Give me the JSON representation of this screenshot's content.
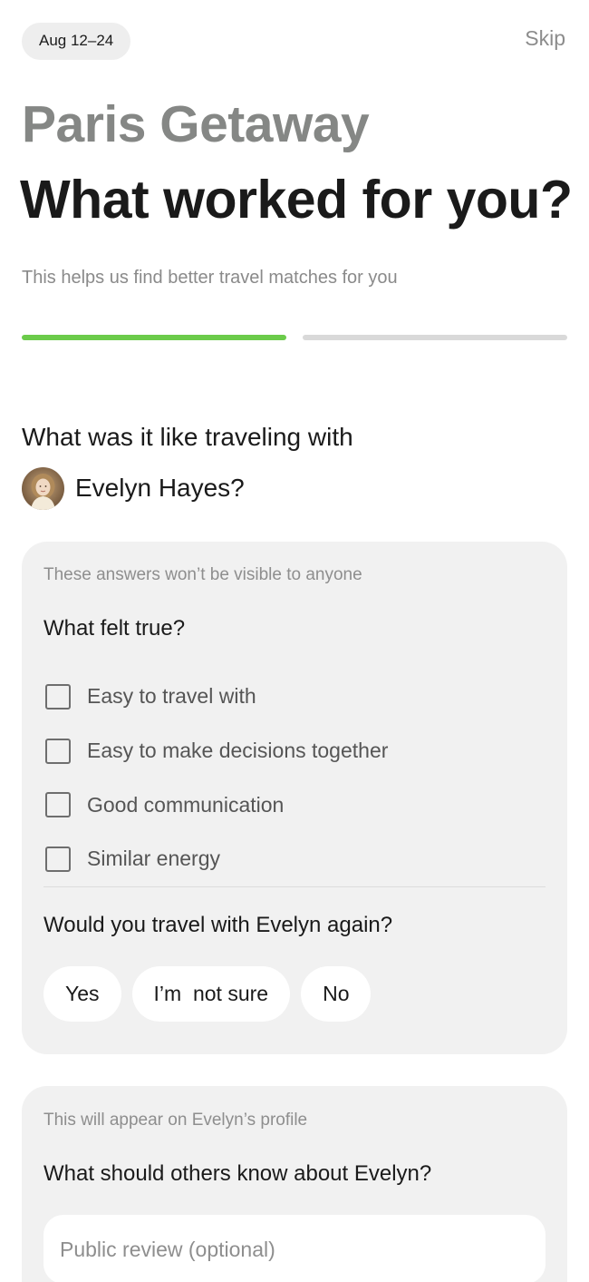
{
  "header": {
    "date_range": "Aug 12–24",
    "skip_label": "Skip"
  },
  "trip_title": "Paris Getaway",
  "page_title": "What worked for you?",
  "subtitle": "This helps us find better travel matches for you",
  "progress": {
    "current_step": 1,
    "total_steps": 2,
    "active_color": "#6bcb4a",
    "inactive_color": "#d9d9d9"
  },
  "traveler": {
    "question": "What was it like traveling with",
    "name_with_punct": "Evelyn Hayes?",
    "avatar_icon": "person-avatar"
  },
  "private_card": {
    "note": "These answers won’t be visible to anyone",
    "question": "What felt true?",
    "options": [
      {
        "label": "Easy to travel with",
        "checked": false
      },
      {
        "label": "Easy to make decisions together",
        "checked": false
      },
      {
        "label": "Good communication",
        "checked": false
      },
      {
        "label": "Similar energy",
        "checked": false
      }
    ],
    "again_question": "Would you travel with Evelyn again?",
    "again_choices": [
      "Yes",
      "I’m  not sure",
      "No"
    ]
  },
  "public_card": {
    "note": "This will appear on Evelyn’s profile",
    "question": "What should others know about Evelyn?",
    "review_placeholder": "Public review (optional)",
    "review_value": ""
  }
}
